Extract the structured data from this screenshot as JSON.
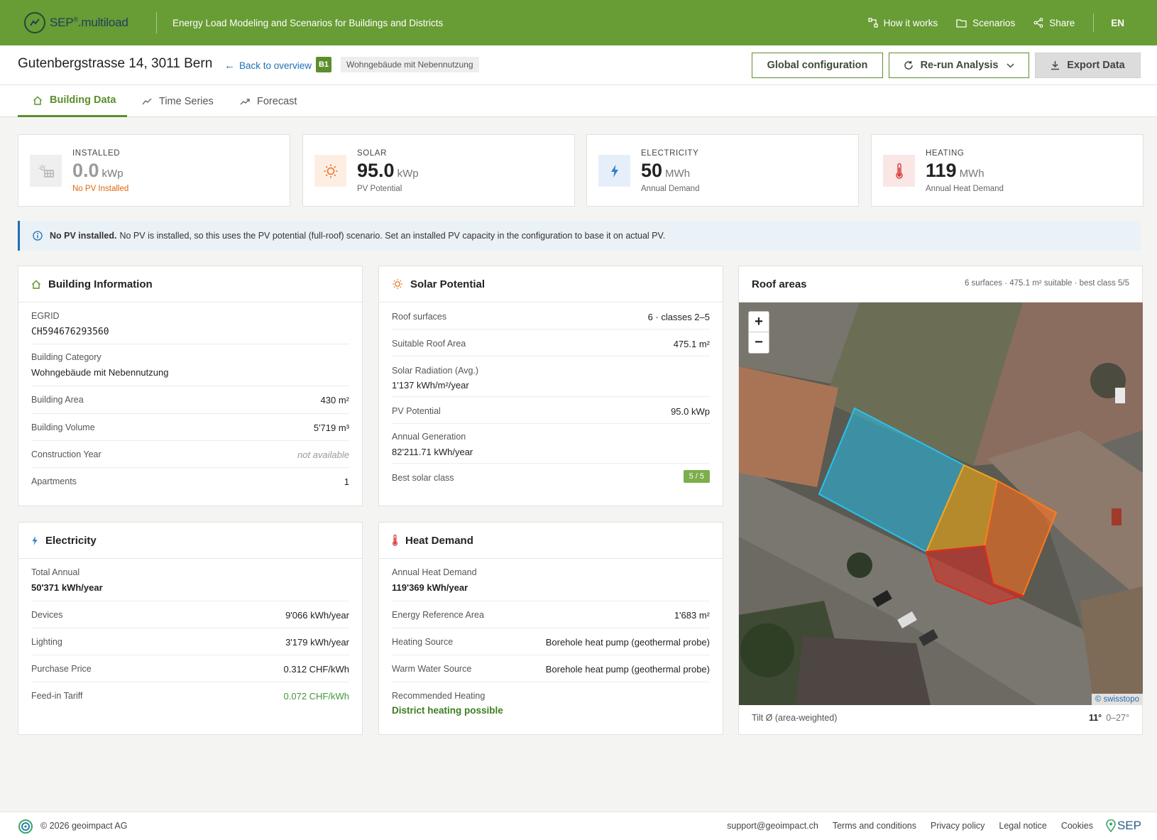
{
  "app": {
    "brand_main": "SEP",
    "brand_reg": "®",
    "brand_suffix": ".multiload",
    "tagline": "Energy Load Modeling and Scenarios for Buildings and Districts",
    "nav": {
      "how_it_works": "How it works",
      "scenarios": "Scenarios",
      "share": "Share",
      "lang": "EN"
    },
    "colors": {
      "brand_green": "#689c35",
      "accent_green": "#5b8f2c",
      "link_blue": "#1f6fb5"
    }
  },
  "header": {
    "address": "Gutenbergstrasse 14, 3011 Bern",
    "back_label": "Back to overview",
    "building_badge": "B1",
    "category_tag": "Wohngebäude mit Nebennutzung",
    "global_config": "Global configuration",
    "rerun": "Re-run Analysis",
    "export": "Export Data"
  },
  "tabs": [
    {
      "label": "Building Data",
      "icon": "home-icon",
      "active": true
    },
    {
      "label": "Time Series",
      "icon": "trend-icon",
      "active": false
    },
    {
      "label": "Forecast",
      "icon": "trend-up-icon",
      "active": false
    }
  ],
  "kpis": [
    {
      "label": "INSTALLED",
      "value": "0.0",
      "unit": "kWp",
      "sub": "No PV Installed",
      "icon": "solar-panel-icon",
      "value_color": "#9a9a9a",
      "sub_color": "#e0650f"
    },
    {
      "label": "SOLAR",
      "value": "95.0",
      "unit": "kWp",
      "sub": "PV Potential",
      "icon": "sun-icon"
    },
    {
      "label": "ELECTRICITY",
      "value": "50",
      "unit": "MWh",
      "sub": "Annual Demand",
      "icon": "bolt-icon"
    },
    {
      "label": "HEATING",
      "value": "119",
      "unit": "MWh",
      "sub": "Annual Heat Demand",
      "icon": "thermometer-icon"
    }
  ],
  "banner": {
    "bold": "No PV installed.",
    "text": "No PV is installed, so this uses the PV potential (full-roof) scenario. Set an installed PV capacity in the configuration to base it on actual PV."
  },
  "building_info": {
    "title": "Building Information",
    "egrid_label": "EGRID",
    "egrid_value": "CH594676293560",
    "category_label": "Building Category",
    "category_value": "Wohngebäude mit Nebennutzung",
    "area_label": "Building Area",
    "area_value": "430 m²",
    "volume_label": "Building Volume",
    "volume_value": "5'719 m³",
    "year_label": "Construction Year",
    "year_value": "not available",
    "apartments_label": "Apartments",
    "apartments_value": "1"
  },
  "solar": {
    "title": "Solar Potential",
    "surfaces_label": "Roof surfaces",
    "surfaces_value": "6 · classes 2–5",
    "suitable_label": "Suitable Roof Area",
    "suitable_value": "475.1 m²",
    "radiation_label": "Solar Radiation (Avg.)",
    "radiation_value": "1'137 kWh/m²/year",
    "pv_label": "PV Potential",
    "pv_value": "95.0 kWp",
    "generation_label": "Annual Generation",
    "generation_value": "82'211.71 kWh/year",
    "best_label": "Best solar class",
    "best_value": "5 / 5"
  },
  "roof": {
    "title": "Roof areas",
    "summary": "6 surfaces · 475.1 m² suitable · best class 5/5",
    "zoom_in": "+",
    "zoom_out": "−",
    "attribution": "© swisstopo",
    "tilt_label": "Tilt Ø (area-weighted)",
    "tilt_value": "11°",
    "tilt_range": "0–27°"
  },
  "electricity": {
    "title": "Electricity",
    "total_label": "Total Annual",
    "total_value": "50'371 kWh/year",
    "devices_label": "Devices",
    "devices_value": "9'066 kWh/year",
    "lighting_label": "Lighting",
    "lighting_value": "3'179 kWh/year",
    "price_label": "Purchase Price",
    "price_value": "0.312 CHF/kWh",
    "feedin_label": "Feed-in Tariff",
    "feedin_value": "0.072 CHF/kWh"
  },
  "heat": {
    "title": "Heat Demand",
    "annual_label": "Annual Heat Demand",
    "annual_value": "119'369 kWh/year",
    "era_label": "Energy Reference Area",
    "era_value": "1'683 m²",
    "source_label": "Heating Source",
    "source_value": "Borehole heat pump (geothermal probe)",
    "water_label": "Warm Water Source",
    "water_value": "Borehole heat pump (geothermal probe)",
    "recommended_label": "Recommended Heating",
    "recommended_value": "District heating possible"
  },
  "footer": {
    "copyright": "© 2026 geoimpact AG",
    "support": "support@geoimpact.ch",
    "terms": "Terms and conditions",
    "privacy": "Privacy policy",
    "legal": "Legal notice",
    "cookies": "Cookies",
    "brand": "SEP"
  }
}
